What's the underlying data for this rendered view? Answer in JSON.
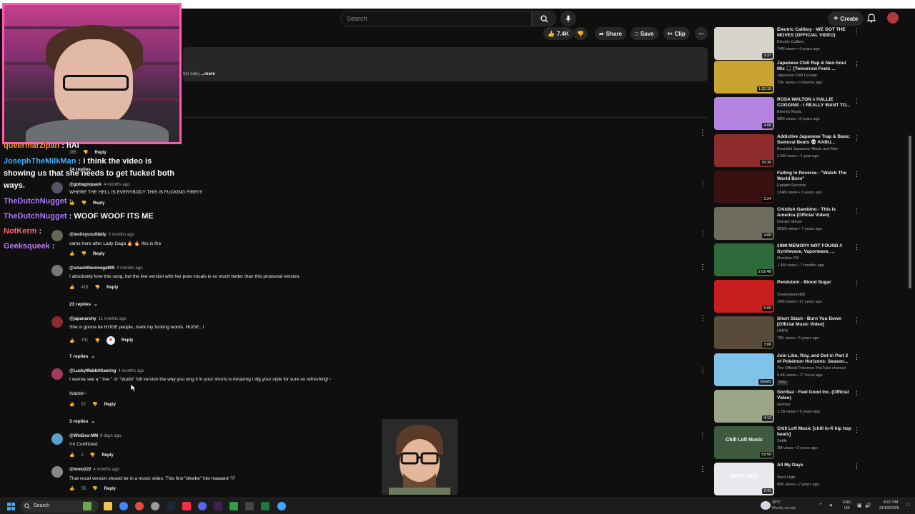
{
  "header": {
    "search_placeholder": "Search",
    "create_label": "Create"
  },
  "actions": {
    "likes": "7.4K",
    "share": "Share",
    "save": "Save",
    "clip": "Clip"
  },
  "description": {
    "snippet": "tter baby",
    "more": "...more"
  },
  "chat": [
    {
      "user": "queermarzipan",
      "sep": " : ",
      "msg": "hAI",
      "color": "#ff9a3c"
    },
    {
      "user": "JosephTheMilkMan",
      "sep": " : ",
      "msg": "I think the video is",
      "color": "#4fb3ff"
    },
    {
      "user": "",
      "sep": "",
      "msg": "showing us that she needs to get fucked both",
      "color": "#fff"
    },
    {
      "user": "",
      "sep": "",
      "msg": "ways.",
      "color": "#fff"
    },
    {
      "user": "TheDutchNugget",
      "sep": " : ",
      "msg": "",
      "color": "#b47dff"
    },
    {
      "user": "TheDutchNugget",
      "sep": " : ",
      "msg": "WOOF WOOF ITS ME",
      "color": "#b47dff"
    },
    {
      "user": "NotKerm",
      "sep": " : ",
      "msg": "",
      "color": "#ff6b6b"
    },
    {
      "user": "Geeksqueek",
      "sep": " : ",
      "msg": "",
      "color": "#c77dff"
    }
  ],
  "comments_partial": [
    {
      "likes": "385",
      "reply": "Reply"
    },
    {
      "replies": "14 replies"
    },
    {
      "name": "@gottagoquack",
      "time": "4 months ago",
      "text": "WHERE THE HELL IS EVERYBODY THIS IS FUCKING FIRE!!!!",
      "reply": "Reply"
    },
    {
      "name": "@inoitsyusufdaily",
      "time": "3 months ago",
      "text": "came here after Lady Gaga 🔥 🔥 this is fire",
      "reply": "Reply"
    }
  ],
  "comments": [
    {
      "name": "@smashtheomega909",
      "time": "4 months ago",
      "text": "I absolutely love this song, but the live version with her pure vocals is so much better than this produced version.",
      "likes": "416",
      "reply": "Reply",
      "replies": "23 replies",
      "avatar_color": "#777"
    },
    {
      "name": "@japanarchy",
      "time": "11 months ago",
      "text": "She is gonna be HUGE people, mark my fucking words. HUGE...!",
      "likes": "191",
      "reply": "Reply",
      "replies": "7 replies",
      "avatar_color": "#8a2d2d"
    },
    {
      "name": "@LuckyWabbitGaming",
      "time": "4 months ago",
      "text": "I wanna see a \" live \" or \"studio\" full version the way you sing it in your shorts is Amazing I dig your style for sure so refreshing!~",
      "text2": "Wabbit~",
      "likes": "67",
      "reply": "Reply",
      "replies": "3 replies",
      "avatar_color": "#a23b5c"
    },
    {
      "name": "@WinDos-MM",
      "time": "8 days ago",
      "text": "I'm Conflicted.",
      "likes": "2",
      "reply": "Reply",
      "avatar_color": "#5aa0c8"
    },
    {
      "name": "@tomo222",
      "time": "4 months ago",
      "text": "That vocal version should be in a music video. This first \"bheibe\" hits haaaard 🖤",
      "likes": "55",
      "reply": "Reply",
      "avatar_color": "#888"
    }
  ],
  "sidebar": [
    {
      "title": "Electric Callboy - WE GOT THE MOVES (OFFICIAL VIDEO)",
      "channel": "Electric Callboy",
      "meta": "74M views • 4 years ago",
      "duration": "3:37",
      "thumb": "#d8d4cc"
    },
    {
      "title": "Japanese Chill Rap & Neo-Soul Mix 🎧 [Tomorrow Feels ...",
      "channel": "Japanese Chill Lounge",
      "meta": "73K views • 3 months ago",
      "duration": "1:12:15",
      "thumb": "#c9a430"
    },
    {
      "title": "ROSA WALTON x HALLIE COGGINS - I REALLY WANT TO...",
      "channel": "Eternity Music",
      "meta": "68M views • 3 years ago",
      "duration": "4:08",
      "thumb": "#b584e0"
    },
    {
      "title": "Addictive Japanese Trap & Bass: Samurai Beats 💀 KABU...",
      "channel": "Beautiful Japanese Music and Men",
      "meta": "2.9M views • 1 year ago",
      "duration": "29:36",
      "thumb": "#8e2b2b"
    },
    {
      "title": "Falling In Reverse - \"Watch The World Burn\"",
      "channel": "Epitaph Records",
      "meta": "134M views • 3 years ago",
      "duration": "3:24",
      "thumb": "#3a1010"
    },
    {
      "title": "Childish Gambino - This Is America (Official Video)",
      "channel": "Donald Glover",
      "meta": "981M views • 7 years ago",
      "duration": "4:05",
      "thumb": "#6e6a5c"
    },
    {
      "title": "1999 MEMORY NOT FOUND // Synthwave, Vaporwave, ...",
      "channel": "Moebius FM",
      "meta": "1.4M views • 7 months ago",
      "duration": "2:02:49",
      "thumb": "#2e6a3a"
    },
    {
      "title": "Pendulum - Blood Sugar",
      "channel": "Shadowwend68",
      "meta": "19M views • 17 years ago",
      "duration": "5:00",
      "thumb": "#c81e1e"
    },
    {
      "title": "Short Stack - Burn You Down [Official Music Video]",
      "channel": "UNFD",
      "meta": "79K views • 5 years ago",
      "duration": "3:06",
      "thumb": "#5a4a3a"
    },
    {
      "title": "Join Liko, Roy, and Dot in Part 2 of Pokémon Horizons: Season...",
      "channel": "The Official Pokémon YouTube channel",
      "meta": "9.4K views • 17 hours ago",
      "duration": "Shorts",
      "thumb": "#7fc4e8",
      "badge": "New"
    },
    {
      "title": "Gorillaz - Feel Good Inc. (Official Video)",
      "channel": "Gorillaz",
      "meta": "1.1B views • 9 years ago",
      "duration": "4:13",
      "thumb": "#9aa58a"
    },
    {
      "title": "Chill Lofi Music [chill lo-fi hip hop beats]",
      "channel": "Settle",
      "meta": "2M views • 3 years ago",
      "duration": "59:50",
      "thumb": "#3e5a3e",
      "overlay": "Chill Lofi Music"
    },
    {
      "title": "All My Days",
      "channel": "West High",
      "meta": "89K views • 2 years ago",
      "duration": "2:41",
      "thumb": "#e8e8ee",
      "overlay": "WEST HIGH"
    }
  ],
  "taskbar": {
    "search": "Search",
    "weather_temp": "20°C",
    "weather_desc": "Mostly cloudy",
    "lang": "ENG",
    "region": "US",
    "time": "8:07 PM",
    "date": "21/03/2025"
  }
}
